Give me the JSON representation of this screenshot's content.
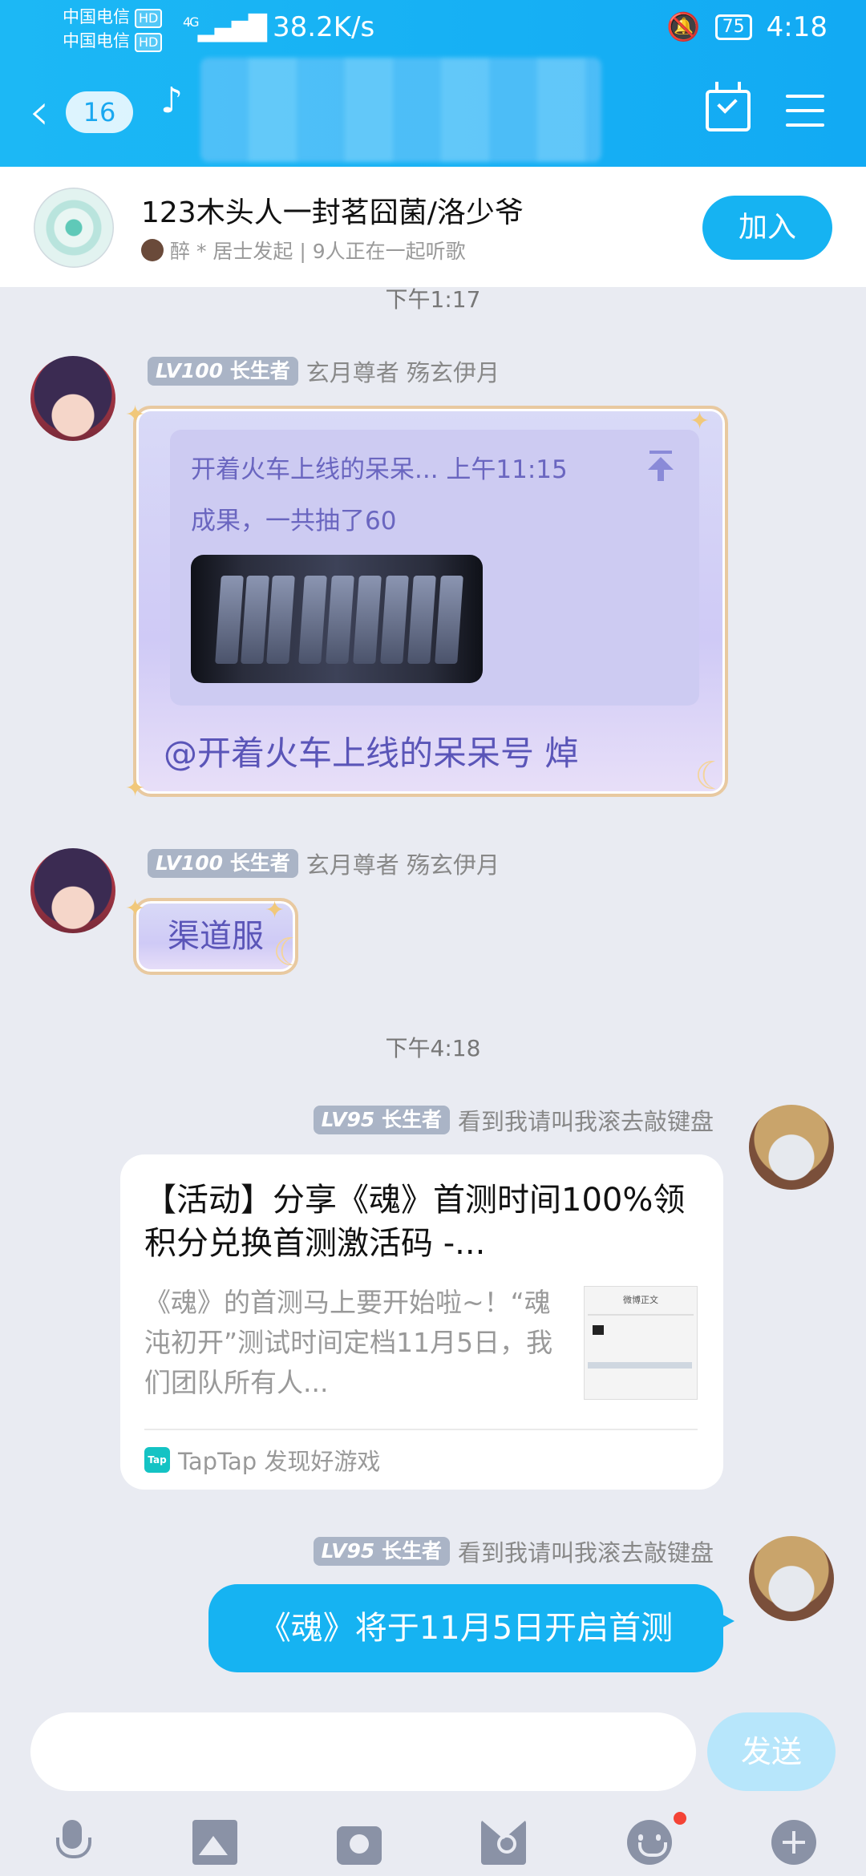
{
  "status": {
    "carrier1": "中国电信",
    "carrier2": "中国电信",
    "hd": "HD",
    "signal": "4G",
    "speed": "38.2K/s",
    "battery": "75",
    "time": "4:18"
  },
  "header": {
    "unread": "16"
  },
  "banner": {
    "title": "123木头人一封茗囧菌/洛少爷",
    "subtitle": "醉 * 居士发起 | 9人正在一起听歌",
    "join": "加入"
  },
  "messages": {
    "time1": "下午1:17",
    "m1": {
      "level": "LV100",
      "badge": "长生者",
      "name": "玄月尊者 殇玄伊月",
      "quote_head": "开着火车上线的呆呆... 上午11:15",
      "quote_text": "成果，一共抽了60",
      "mention": "@开着火车上线的呆呆号 焯"
    },
    "m2": {
      "level": "LV100",
      "badge": "长生者",
      "name": "玄月尊者 殇玄伊月",
      "text": "渠道服"
    },
    "time2": "下午4:18",
    "m3": {
      "level": "LV95",
      "badge": "长生者",
      "name": "看到我请叫我滚去敲键盘",
      "card_title": "【活动】分享《魂》首测时间100%领积分兑换首测激活码 -...",
      "card_desc": "《魂》的首测马上要开始啦~！“魂沌初开”测试时间定档11月5日，我们团队所有人...",
      "thumb_title": "微博正文",
      "source_logo": "Tap",
      "source": "TapTap 发现好游戏"
    },
    "m4": {
      "level": "LV95",
      "badge": "长生者",
      "name": "看到我请叫我滚去敲键盘",
      "text": "《魂》将于11月5日开启首测"
    }
  },
  "input": {
    "send": "发送"
  },
  "icons": [
    "mic-icon",
    "image-icon",
    "camera-icon",
    "red-packet-icon",
    "emoji-icon",
    "plus-icon"
  ]
}
